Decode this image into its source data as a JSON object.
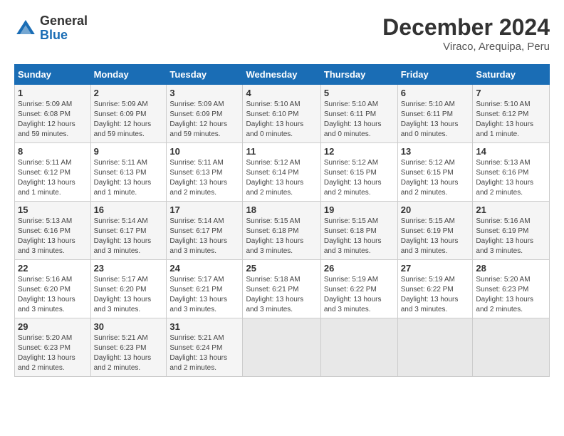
{
  "header": {
    "logo_general": "General",
    "logo_blue": "Blue",
    "month": "December 2024",
    "location": "Viraco, Arequipa, Peru"
  },
  "days_of_week": [
    "Sunday",
    "Monday",
    "Tuesday",
    "Wednesday",
    "Thursday",
    "Friday",
    "Saturday"
  ],
  "weeks": [
    [
      {
        "day": "1",
        "info": "Sunrise: 5:09 AM\nSunset: 6:08 PM\nDaylight: 12 hours\nand 59 minutes."
      },
      {
        "day": "2",
        "info": "Sunrise: 5:09 AM\nSunset: 6:09 PM\nDaylight: 12 hours\nand 59 minutes."
      },
      {
        "day": "3",
        "info": "Sunrise: 5:09 AM\nSunset: 6:09 PM\nDaylight: 12 hours\nand 59 minutes."
      },
      {
        "day": "4",
        "info": "Sunrise: 5:10 AM\nSunset: 6:10 PM\nDaylight: 13 hours\nand 0 minutes."
      },
      {
        "day": "5",
        "info": "Sunrise: 5:10 AM\nSunset: 6:11 PM\nDaylight: 13 hours\nand 0 minutes."
      },
      {
        "day": "6",
        "info": "Sunrise: 5:10 AM\nSunset: 6:11 PM\nDaylight: 13 hours\nand 0 minutes."
      },
      {
        "day": "7",
        "info": "Sunrise: 5:10 AM\nSunset: 6:12 PM\nDaylight: 13 hours\nand 1 minute."
      }
    ],
    [
      {
        "day": "8",
        "info": "Sunrise: 5:11 AM\nSunset: 6:12 PM\nDaylight: 13 hours\nand 1 minute."
      },
      {
        "day": "9",
        "info": "Sunrise: 5:11 AM\nSunset: 6:13 PM\nDaylight: 13 hours\nand 1 minute."
      },
      {
        "day": "10",
        "info": "Sunrise: 5:11 AM\nSunset: 6:13 PM\nDaylight: 13 hours\nand 2 minutes."
      },
      {
        "day": "11",
        "info": "Sunrise: 5:12 AM\nSunset: 6:14 PM\nDaylight: 13 hours\nand 2 minutes."
      },
      {
        "day": "12",
        "info": "Sunrise: 5:12 AM\nSunset: 6:15 PM\nDaylight: 13 hours\nand 2 minutes."
      },
      {
        "day": "13",
        "info": "Sunrise: 5:12 AM\nSunset: 6:15 PM\nDaylight: 13 hours\nand 2 minutes."
      },
      {
        "day": "14",
        "info": "Sunrise: 5:13 AM\nSunset: 6:16 PM\nDaylight: 13 hours\nand 2 minutes."
      }
    ],
    [
      {
        "day": "15",
        "info": "Sunrise: 5:13 AM\nSunset: 6:16 PM\nDaylight: 13 hours\nand 3 minutes."
      },
      {
        "day": "16",
        "info": "Sunrise: 5:14 AM\nSunset: 6:17 PM\nDaylight: 13 hours\nand 3 minutes."
      },
      {
        "day": "17",
        "info": "Sunrise: 5:14 AM\nSunset: 6:17 PM\nDaylight: 13 hours\nand 3 minutes."
      },
      {
        "day": "18",
        "info": "Sunrise: 5:15 AM\nSunset: 6:18 PM\nDaylight: 13 hours\nand 3 minutes."
      },
      {
        "day": "19",
        "info": "Sunrise: 5:15 AM\nSunset: 6:18 PM\nDaylight: 13 hours\nand 3 minutes."
      },
      {
        "day": "20",
        "info": "Sunrise: 5:15 AM\nSunset: 6:19 PM\nDaylight: 13 hours\nand 3 minutes."
      },
      {
        "day": "21",
        "info": "Sunrise: 5:16 AM\nSunset: 6:19 PM\nDaylight: 13 hours\nand 3 minutes."
      }
    ],
    [
      {
        "day": "22",
        "info": "Sunrise: 5:16 AM\nSunset: 6:20 PM\nDaylight: 13 hours\nand 3 minutes."
      },
      {
        "day": "23",
        "info": "Sunrise: 5:17 AM\nSunset: 6:20 PM\nDaylight: 13 hours\nand 3 minutes."
      },
      {
        "day": "24",
        "info": "Sunrise: 5:17 AM\nSunset: 6:21 PM\nDaylight: 13 hours\nand 3 minutes."
      },
      {
        "day": "25",
        "info": "Sunrise: 5:18 AM\nSunset: 6:21 PM\nDaylight: 13 hours\nand 3 minutes."
      },
      {
        "day": "26",
        "info": "Sunrise: 5:19 AM\nSunset: 6:22 PM\nDaylight: 13 hours\nand 3 minutes."
      },
      {
        "day": "27",
        "info": "Sunrise: 5:19 AM\nSunset: 6:22 PM\nDaylight: 13 hours\nand 3 minutes."
      },
      {
        "day": "28",
        "info": "Sunrise: 5:20 AM\nSunset: 6:23 PM\nDaylight: 13 hours\nand 2 minutes."
      }
    ],
    [
      {
        "day": "29",
        "info": "Sunrise: 5:20 AM\nSunset: 6:23 PM\nDaylight: 13 hours\nand 2 minutes."
      },
      {
        "day": "30",
        "info": "Sunrise: 5:21 AM\nSunset: 6:23 PM\nDaylight: 13 hours\nand 2 minutes."
      },
      {
        "day": "31",
        "info": "Sunrise: 5:21 AM\nSunset: 6:24 PM\nDaylight: 13 hours\nand 2 minutes."
      },
      {
        "day": "",
        "info": ""
      },
      {
        "day": "",
        "info": ""
      },
      {
        "day": "",
        "info": ""
      },
      {
        "day": "",
        "info": ""
      }
    ]
  ]
}
